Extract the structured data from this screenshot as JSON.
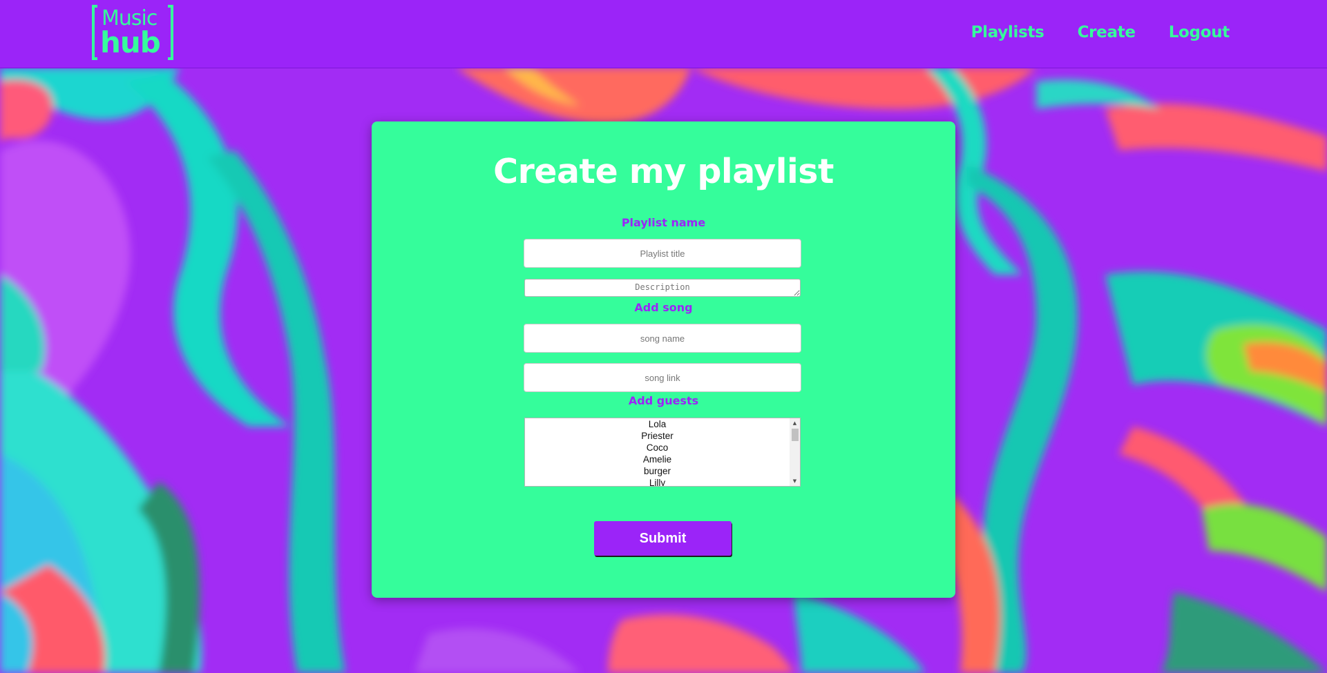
{
  "header": {
    "logo_line1": "Music",
    "logo_line2": "hub",
    "nav": [
      {
        "label": "Playlists"
      },
      {
        "label": "Create"
      },
      {
        "label": "Logout"
      }
    ]
  },
  "form": {
    "title": "Create my playlist",
    "playlist_name_label": "Playlist name",
    "title_placeholder": "Playlist title",
    "title_value": "",
    "description_placeholder": "Description",
    "description_value": "",
    "add_song_label": "Add song",
    "song_name_placeholder": "song name",
    "song_name_value": "",
    "song_link_placeholder": "song link",
    "song_link_value": "",
    "add_guests_label": "Add guests",
    "guests": [
      "Lola",
      "Priester",
      "Coco",
      "Amelie",
      "burger",
      "Lilly"
    ],
    "submit_label": "Submit"
  },
  "colors": {
    "header_bg": "#9b24f8",
    "accent_green": "#36fc9c",
    "card_bg": "#35fd9b",
    "label_purple": "#9b24f8",
    "button_bg": "#9b24f8"
  },
  "icons": {
    "scroll_up": "scroll-up-arrow-icon",
    "scroll_down": "scroll-down-arrow-icon",
    "resize_handle": "textarea-resize-icon"
  }
}
